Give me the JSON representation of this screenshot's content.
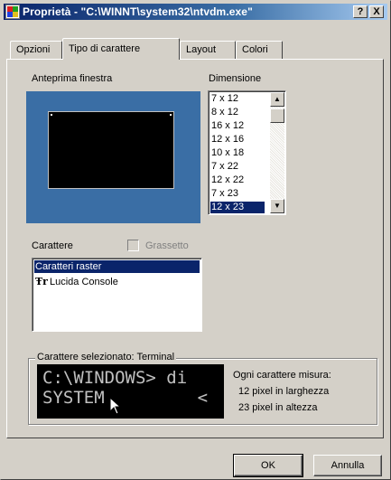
{
  "window": {
    "title": "Proprietà - \"C:\\WINNT\\system32\\ntvdm.exe\"",
    "help_button": "?",
    "close_button": "X"
  },
  "tabs": [
    {
      "label": "Opzioni",
      "active": false
    },
    {
      "label": "Tipo di carattere",
      "active": true
    },
    {
      "label": "Layout",
      "active": false
    },
    {
      "label": "Colori",
      "active": false
    }
  ],
  "preview": {
    "label": "Anteprima finestra",
    "desktop_color": "#3a6ea5"
  },
  "dimension": {
    "label": "Dimensione",
    "items": [
      "7 x 12",
      "8 x 12",
      "16 x 12",
      "12 x 16",
      "10 x 18",
      "7 x 22",
      "12 x 22",
      "7 x 23",
      "12 x 23"
    ],
    "selected": "12 x 23"
  },
  "font": {
    "label": "Carattere",
    "bold_label": "Grassetto",
    "bold_checked": false,
    "bold_enabled": false,
    "items": [
      {
        "label": "Caratteri raster",
        "icon": "",
        "selected": true
      },
      {
        "label": "Lucida Console",
        "icon": "truetype-icon",
        "selected": false
      }
    ]
  },
  "selected_font": {
    "group_title": "Carattere selezionato: Terminal",
    "preview_line1": "C:\\WINDOWS> di",
    "preview_line2": "SYSTEM         <",
    "measure_title": "Ogni carattere misura:",
    "width_text": "12 pixel in larghezza",
    "height_text": "23 pixel in altezza"
  },
  "buttons": {
    "ok": "OK",
    "cancel": "Annulla"
  },
  "colors": {
    "selection": "#0a246a",
    "face": "#d4d0c8"
  }
}
